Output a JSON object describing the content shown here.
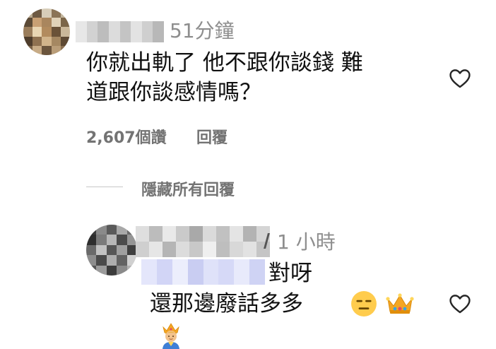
{
  "comment": {
    "time": "51分鐘",
    "text_line1": "你就出軌了 他不跟你談錢 難",
    "text_line2": "道跟你談感情嗎？",
    "likes": "2,607個讚",
    "reply_label": "回覆"
  },
  "hide_replies": "隱藏所有回覆",
  "reply": {
    "time": "1 小時",
    "text_line1": "對呀",
    "text_line2": "還那邊廢話多多"
  },
  "icons": {
    "heart": "heart-outline-icon",
    "emoji_face": "expressionless-face-emoji",
    "emoji_crown": "crown-emoji",
    "emoji_prince": "prince-emoji"
  },
  "colors": {
    "secondary_text": "#737373",
    "timestamp": "#8e8e8e",
    "divider": "#c7c7c7"
  }
}
